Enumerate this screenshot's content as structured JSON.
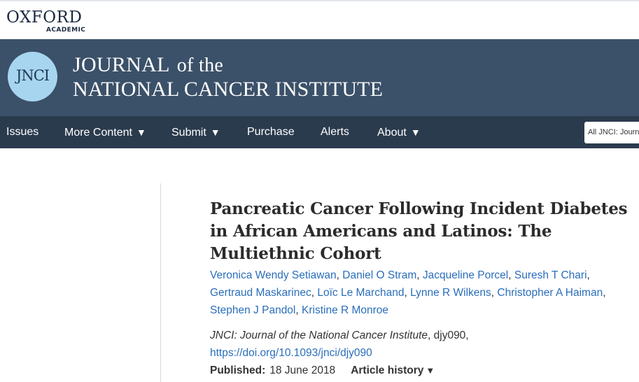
{
  "brand": {
    "oxford_word": "OXFORD",
    "academic_word": "ACADEMIC"
  },
  "journal": {
    "logo_text": "JNCI",
    "title_line1_a": "JOURNAL",
    "title_line1_b": "of the",
    "title_line2": "NATIONAL CANCER INSTITUTE"
  },
  "nav": {
    "items": [
      {
        "label": "Issues",
        "has_dropdown": false
      },
      {
        "label": "More Content",
        "has_dropdown": true
      },
      {
        "label": "Submit",
        "has_dropdown": true
      },
      {
        "label": "Purchase",
        "has_dropdown": false
      },
      {
        "label": "Alerts",
        "has_dropdown": false
      },
      {
        "label": "About",
        "has_dropdown": true
      }
    ],
    "dropdown_caret": "▼",
    "search_scope": "All JNCI: Journ"
  },
  "article": {
    "title": "Pancreatic Cancer Following Incident Diabetes in African Americans and Latinos: The Multiethnic Cohort",
    "authors": [
      "Veronica Wendy Setiawan",
      "Daniel O Stram",
      "Jacqueline Porcel",
      "Suresh T Chari",
      "Gertraud Maskarinec",
      "Loïc Le Marchand",
      "Lynne R Wilkens",
      "Christopher A Haiman",
      "Stephen J Pandol",
      "Kristine R Monroe"
    ],
    "author_separator": ",",
    "journal_name": "JNCI: Journal of the National Cancer Institute",
    "article_id": ", djy090,",
    "doi": "https://doi.org/10.1093/jnci/djy090",
    "published_label": "Published:",
    "published_date": "18 June 2018",
    "history_label": "Article history",
    "history_caret": "▼"
  },
  "colors": {
    "banner": "#3b5169",
    "nav": "#2b3b4e",
    "logo_circle": "#a7d5ef",
    "link": "#2a6ebb"
  }
}
